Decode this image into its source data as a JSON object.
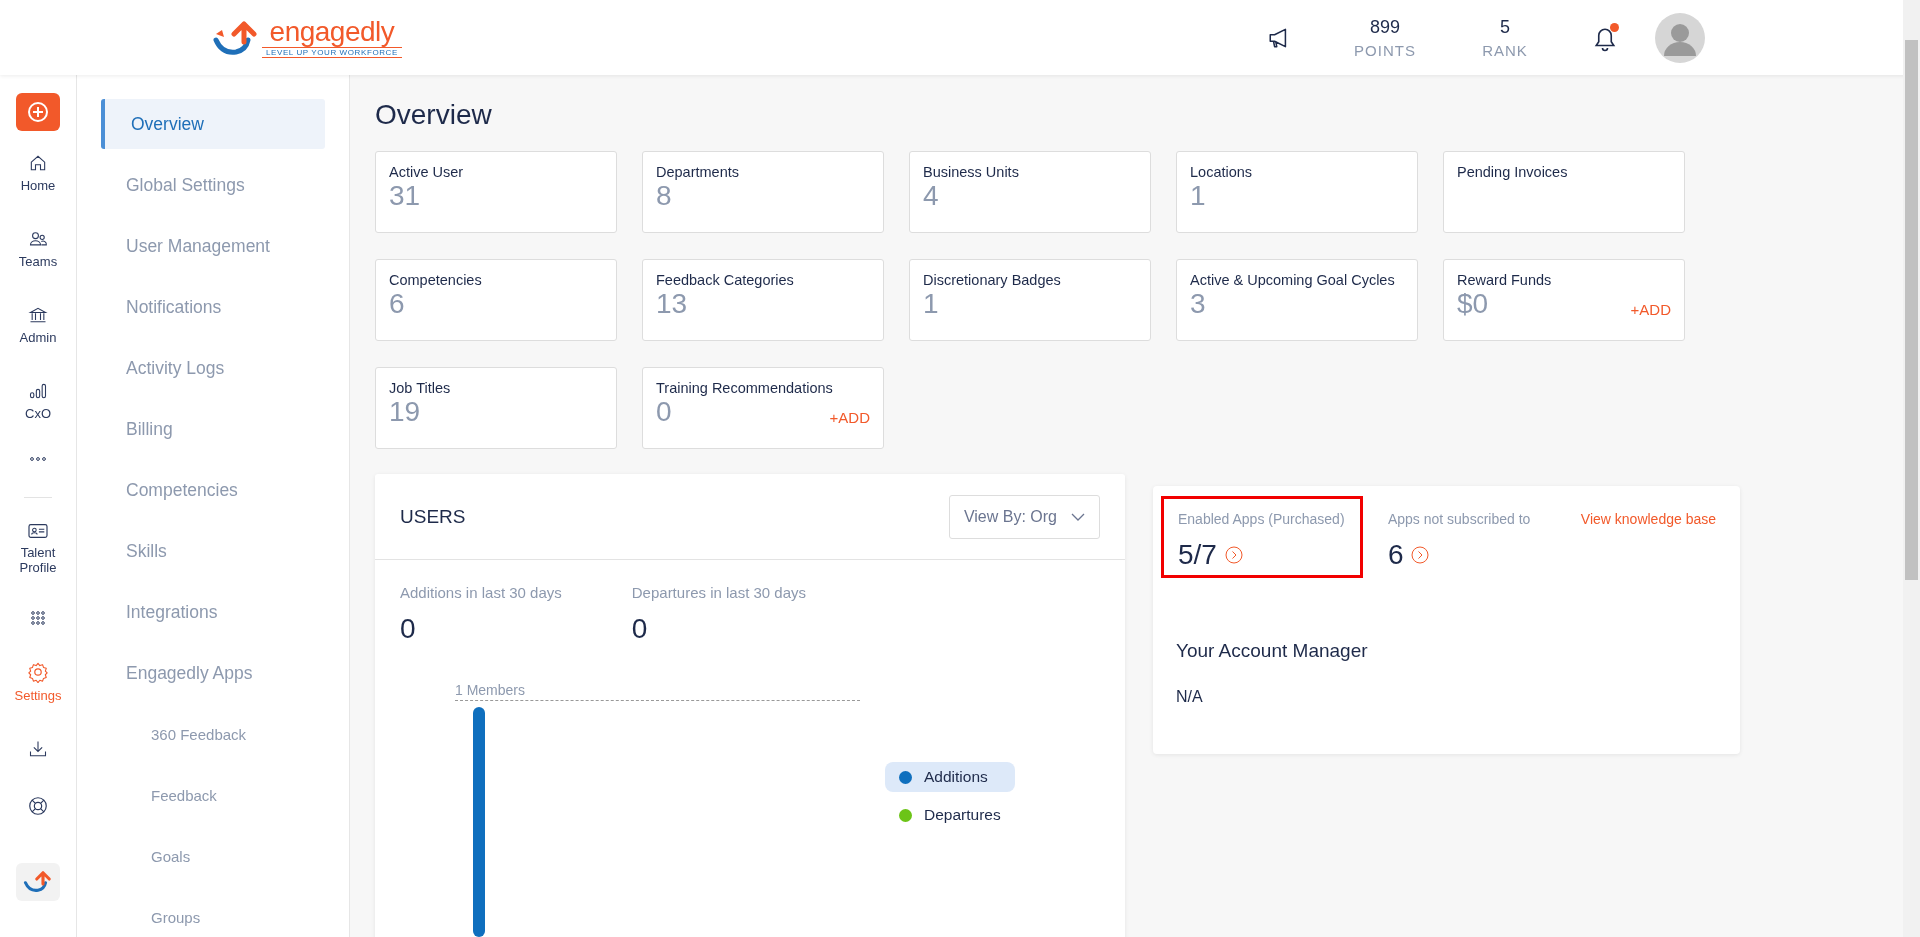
{
  "header": {
    "logo": {
      "wordmark": "engagedly",
      "tagline": "LEVEL UP YOUR WORKFORCE"
    },
    "points": {
      "value": "899",
      "label": "POINTS"
    },
    "rank": {
      "value": "5",
      "label": "RANK"
    },
    "notifications": {
      "unread": true
    }
  },
  "rail": [
    {
      "selected": false
    },
    {
      "label": "Home",
      "selected": false
    },
    {
      "label": "Teams",
      "selected": false
    },
    {
      "label": "Admin",
      "selected": false
    },
    {
      "label": "CxO",
      "selected": false
    },
    {
      "selected": false
    },
    {
      "label": "Talent Profile",
      "selected": false
    },
    {
      "selected": false
    },
    {
      "label": "Settings",
      "selected": true
    },
    {
      "selected": false
    },
    {
      "selected": false
    },
    {
      "selected": false
    }
  ],
  "menu": [
    {
      "label": "Overview",
      "selected": true
    },
    {
      "label": "Global Settings",
      "selected": false
    },
    {
      "label": "User Management",
      "selected": false
    },
    {
      "label": "Notifications",
      "selected": false
    },
    {
      "label": "Activity Logs",
      "selected": false
    },
    {
      "label": "Billing",
      "selected": false
    },
    {
      "label": "Competencies",
      "selected": false
    },
    {
      "label": "Skills",
      "selected": false
    },
    {
      "label": "Integrations",
      "selected": false
    },
    {
      "label": "Engagedly Apps",
      "selected": false,
      "children": [
        {
          "label": "360 Feedback",
          "selected": false
        },
        {
          "label": "Feedback",
          "selected": false
        },
        {
          "label": "Goals",
          "selected": false
        },
        {
          "label": "Groups",
          "selected": false
        }
      ]
    }
  ],
  "page_title": "Overview",
  "stats": [
    {
      "label": "Active User",
      "value": "31"
    },
    {
      "label": "Departments",
      "value": "8"
    },
    {
      "label": "Business Units",
      "value": "4"
    },
    {
      "label": "Locations",
      "value": "1"
    },
    {
      "label": "Pending Invoices"
    },
    {
      "label": "Competencies",
      "value": "6"
    },
    {
      "label": "Feedback Categories",
      "value": "13"
    },
    {
      "label": "Discretionary Badges",
      "value": "1"
    },
    {
      "label": "Active & Upcoming Goal Cycles",
      "value": "3"
    },
    {
      "label": "Reward Funds",
      "value": "$0",
      "action": "+ADD"
    },
    {
      "label": "Job Titles",
      "value": "19"
    },
    {
      "label": "Training Recommendations",
      "value": "0",
      "action": "+ADD"
    }
  ],
  "users": {
    "title": "USERS",
    "view_by": "View By: Org",
    "metrics": [
      {
        "label": "Additions in last 30 days",
        "value": "0"
      },
      {
        "label": "Departures in last 30 days",
        "value": "0"
      }
    ],
    "reference_label": "1 Members",
    "legend": [
      {
        "label": "Additions",
        "color": "#0f6fbe",
        "selected": true
      },
      {
        "label": "Departures",
        "color": "#6cc417",
        "selected": false
      }
    ]
  },
  "apps": {
    "items": [
      {
        "label": "Enabled Apps (Purchased)",
        "value": "5/7",
        "highlighted": true
      },
      {
        "label": "Apps not subscribed to",
        "value": "6",
        "highlighted": false
      }
    ],
    "link": "View knowledge base",
    "manager_title": "Your Account Manager",
    "manager": "N/A"
  }
}
